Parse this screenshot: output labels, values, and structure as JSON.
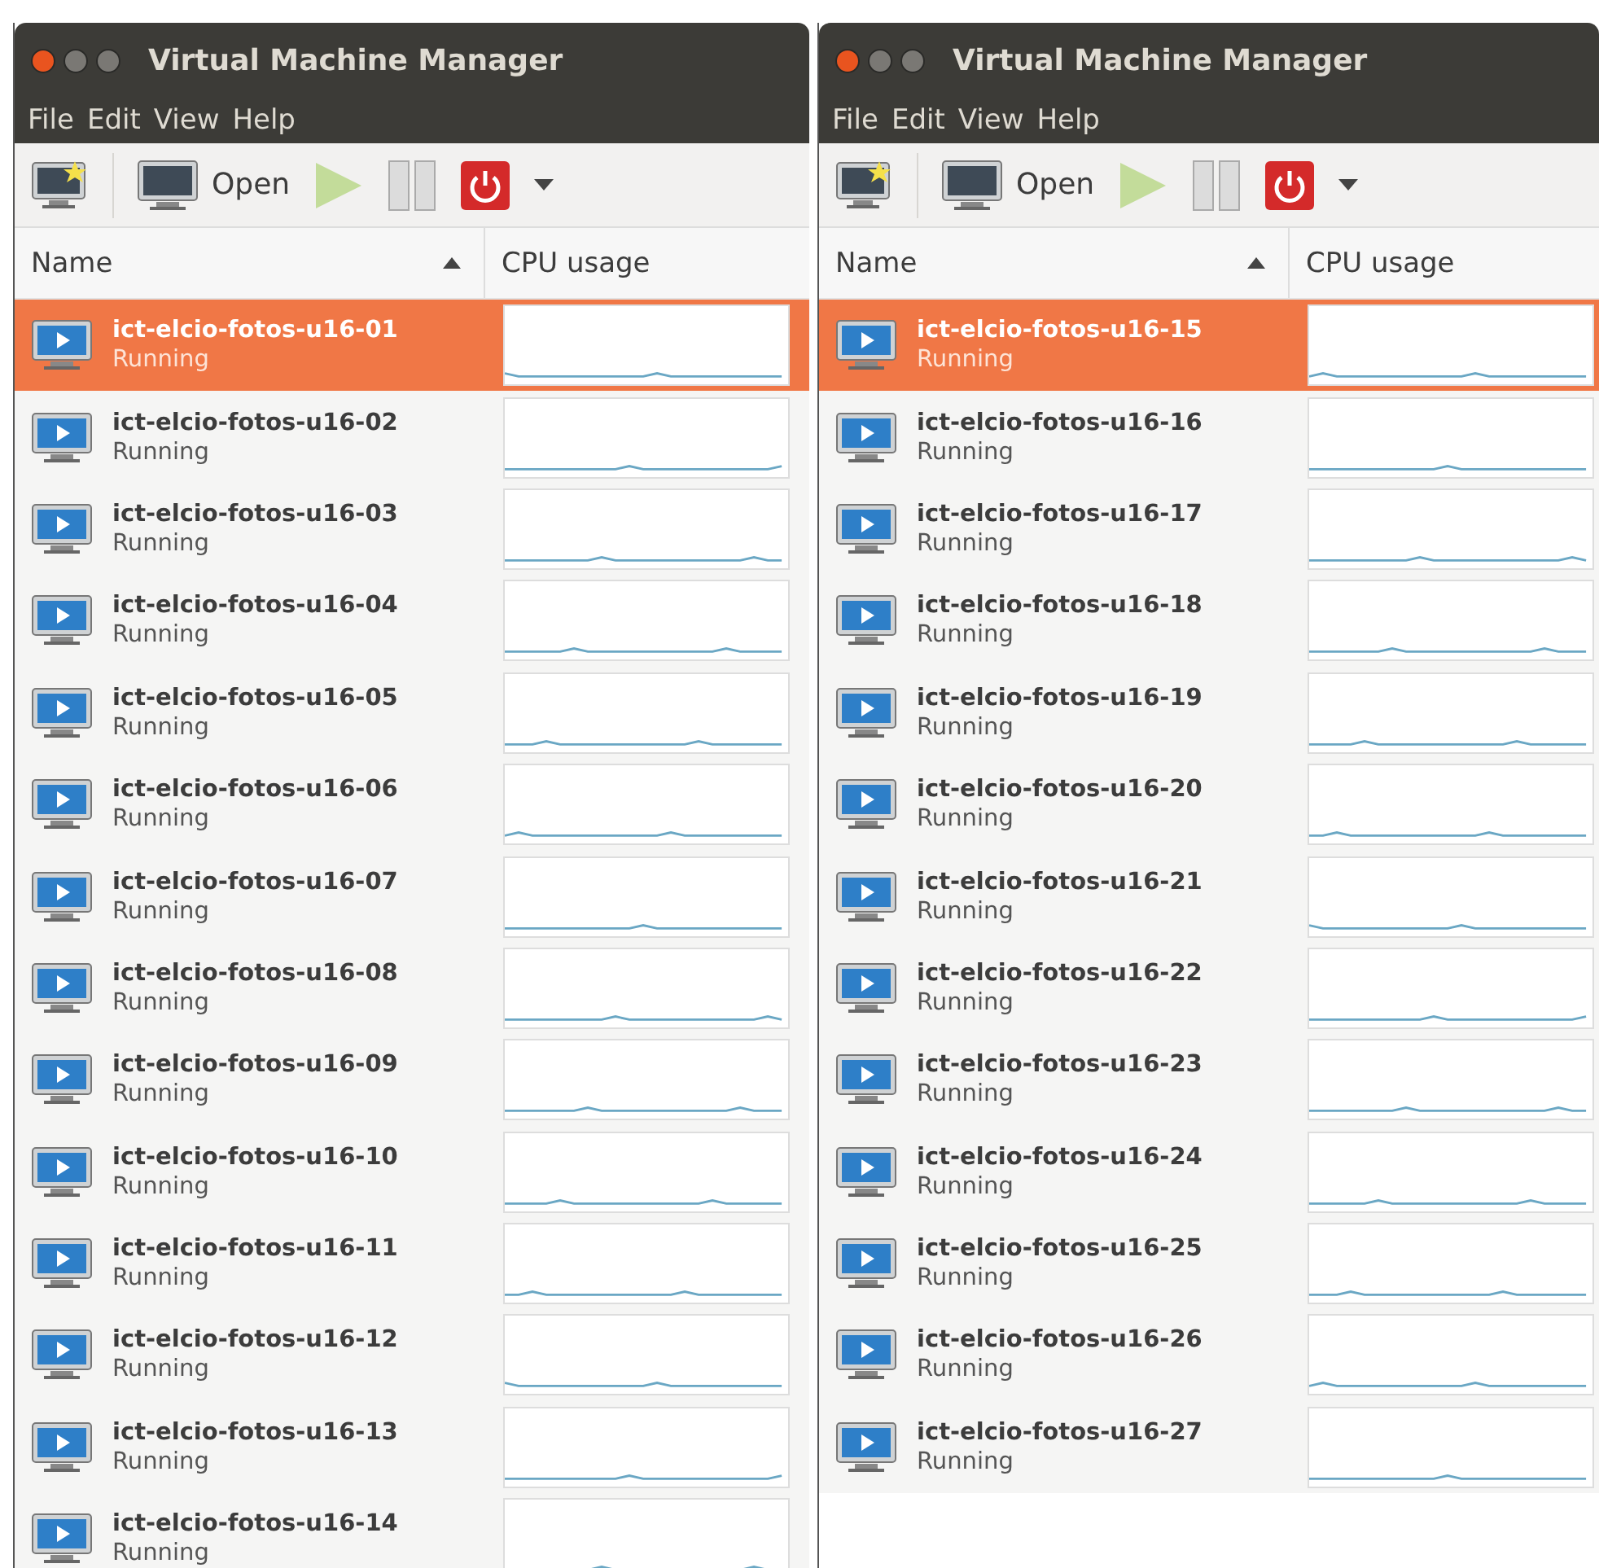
{
  "windows": [
    {
      "title": "Virtual Machine Manager",
      "menu": [
        "File",
        "Edit",
        "View",
        "Help"
      ],
      "toolbar": {
        "open_label": "Open"
      },
      "columns": [
        {
          "label": "Name",
          "sorted": true
        },
        {
          "label": "CPU usage",
          "sorted": false
        }
      ],
      "rows": [
        {
          "name": "ict-elcio-fotos-u16-01",
          "status": "Running",
          "selected": true
        },
        {
          "name": "ict-elcio-fotos-u16-02",
          "status": "Running",
          "selected": false
        },
        {
          "name": "ict-elcio-fotos-u16-03",
          "status": "Running",
          "selected": false
        },
        {
          "name": "ict-elcio-fotos-u16-04",
          "status": "Running",
          "selected": false
        },
        {
          "name": "ict-elcio-fotos-u16-05",
          "status": "Running",
          "selected": false
        },
        {
          "name": "ict-elcio-fotos-u16-06",
          "status": "Running",
          "selected": false
        },
        {
          "name": "ict-elcio-fotos-u16-07",
          "status": "Running",
          "selected": false
        },
        {
          "name": "ict-elcio-fotos-u16-08",
          "status": "Running",
          "selected": false
        },
        {
          "name": "ict-elcio-fotos-u16-09",
          "status": "Running",
          "selected": false
        },
        {
          "name": "ict-elcio-fotos-u16-10",
          "status": "Running",
          "selected": false
        },
        {
          "name": "ict-elcio-fotos-u16-11",
          "status": "Running",
          "selected": false
        },
        {
          "name": "ict-elcio-fotos-u16-12",
          "status": "Running",
          "selected": false
        },
        {
          "name": "ict-elcio-fotos-u16-13",
          "status": "Running",
          "selected": false
        },
        {
          "name": "ict-elcio-fotos-u16-14",
          "status": "Running",
          "selected": false
        }
      ]
    },
    {
      "title": "Virtual Machine Manager",
      "menu": [
        "File",
        "Edit",
        "View",
        "Help"
      ],
      "toolbar": {
        "open_label": "Open"
      },
      "columns": [
        {
          "label": "Name",
          "sorted": true
        },
        {
          "label": "CPU usage",
          "sorted": false
        }
      ],
      "rows": [
        {
          "name": "ict-elcio-fotos-u16-15",
          "status": "Running",
          "selected": true
        },
        {
          "name": "ict-elcio-fotos-u16-16",
          "status": "Running",
          "selected": false
        },
        {
          "name": "ict-elcio-fotos-u16-17",
          "status": "Running",
          "selected": false
        },
        {
          "name": "ict-elcio-fotos-u16-18",
          "status": "Running",
          "selected": false
        },
        {
          "name": "ict-elcio-fotos-u16-19",
          "status": "Running",
          "selected": false
        },
        {
          "name": "ict-elcio-fotos-u16-20",
          "status": "Running",
          "selected": false
        },
        {
          "name": "ict-elcio-fotos-u16-21",
          "status": "Running",
          "selected": false
        },
        {
          "name": "ict-elcio-fotos-u16-22",
          "status": "Running",
          "selected": false
        },
        {
          "name": "ict-elcio-fotos-u16-23",
          "status": "Running",
          "selected": false
        },
        {
          "name": "ict-elcio-fotos-u16-24",
          "status": "Running",
          "selected": false
        },
        {
          "name": "ict-elcio-fotos-u16-25",
          "status": "Running",
          "selected": false
        },
        {
          "name": "ict-elcio-fotos-u16-26",
          "status": "Running",
          "selected": false
        },
        {
          "name": "ict-elcio-fotos-u16-27",
          "status": "Running",
          "selected": false
        }
      ]
    }
  ]
}
